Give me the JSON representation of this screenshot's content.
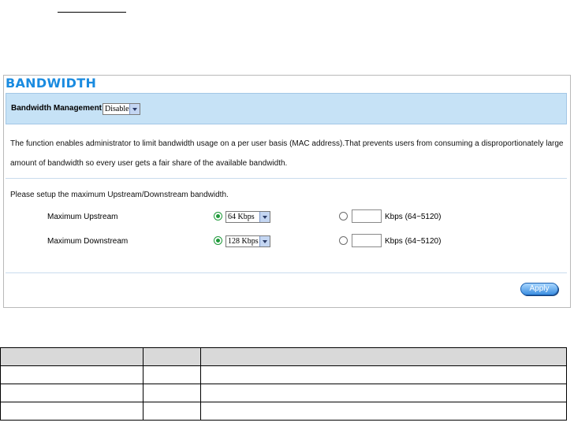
{
  "panel": {
    "title": "BANDWIDTH",
    "management": {
      "label": "Bandwidth Management:",
      "selected": "Disable"
    },
    "description": {
      "line1": "The function enables administrator to limit bandwidth usage on a per user basis (MAC address).That prevents users from consuming a disproportionately large",
      "line2": "amount of bandwidth so every user gets a fair share of the available bandwidth."
    },
    "setup_prompt": "Please setup the maximum Upstream/Downstream bandwidth.",
    "upstream": {
      "label": "Maximum Upstream",
      "preset_selected": "64 Kbps",
      "preset_mode": "selected",
      "custom_value": "",
      "custom_label": "Kbps (64~5120)"
    },
    "downstream": {
      "label": "Maximum Downstream",
      "preset_selected": "128 Kbps",
      "preset_mode": "selected",
      "custom_value": "",
      "custom_label": "Kbps (64~5120)"
    },
    "apply_label": "Apply"
  },
  "colors": {
    "title": "#1a8be0",
    "header_bar": "#c6e2f6",
    "radio_selected": "#1f9a3a",
    "apply_button": "#3d8fe0"
  },
  "table": {
    "rows": [
      [
        "",
        "",
        ""
      ],
      [
        "",
        "",
        ""
      ],
      [
        "",
        "",
        ""
      ],
      [
        "",
        "",
        ""
      ]
    ]
  }
}
